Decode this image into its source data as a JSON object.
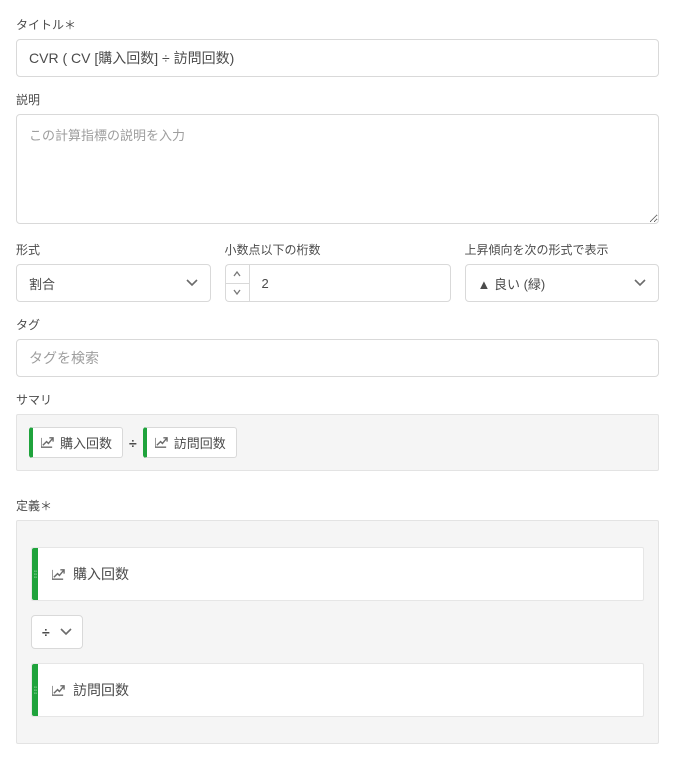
{
  "title": {
    "label": "タイトル＊",
    "value": "CVR ( CV [購入回数] ÷ 訪問回数)"
  },
  "description": {
    "label": "説明",
    "placeholder": "この計算指標の説明を入力"
  },
  "format": {
    "label": "形式",
    "value": "割合"
  },
  "decimals": {
    "label": "小数点以下の桁数",
    "value": "2"
  },
  "trend": {
    "label": "上昇傾向を次の形式で表示",
    "value": "▲ 良い (緑)"
  },
  "tag": {
    "label": "タグ",
    "placeholder": "タグを検索"
  },
  "summary": {
    "label": "サマリ",
    "item1": "購入回数",
    "operator": "÷",
    "item2": "訪問回数"
  },
  "definition": {
    "label": "定義＊",
    "row1": "購入回数",
    "operator": "÷",
    "row2": "訪問回数"
  }
}
